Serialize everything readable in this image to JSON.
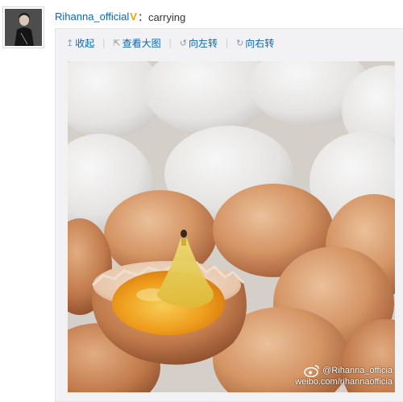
{
  "post": {
    "username": "Rihanna_official",
    "verified_icon": "V",
    "text": "：carrying"
  },
  "toolbar": {
    "collapse_icon": "↥",
    "collapse_label": "收起",
    "view_large_icon": "⇱",
    "view_large_label": "查看大图",
    "rotate_left_icon": "↺",
    "rotate_left_label": "向左转",
    "rotate_right_icon": "↻",
    "rotate_right_label": "向右转"
  },
  "image": {
    "subject": "eggs-with-tiny-figure-in-yolk",
    "watermark_handle": "@Rihanna_officia",
    "watermark_url": "weibo.com/rihannaofficia"
  },
  "colors": {
    "link": "#0a66b7",
    "verified": "#f0a30a",
    "panel_bg": "#f2f2f5"
  }
}
